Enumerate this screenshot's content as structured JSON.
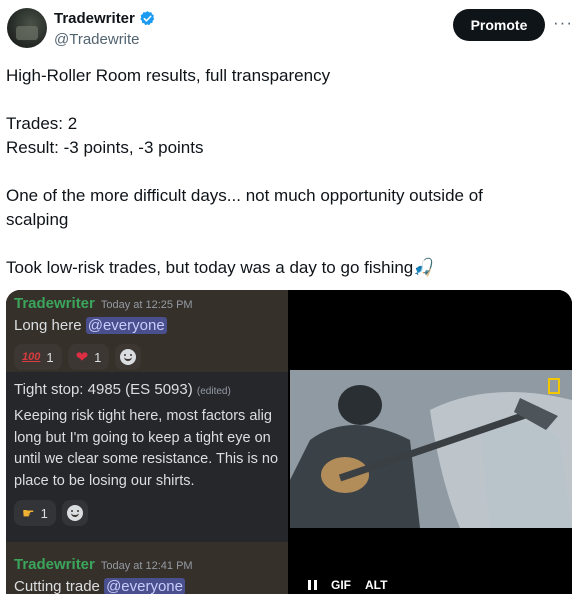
{
  "author": {
    "name": "Tradewriter",
    "handle": "@Tradewrite",
    "verified": true
  },
  "header": {
    "promote_label": "Promote",
    "more_label": "···"
  },
  "tweet": {
    "line1": "High-Roller Room results, full transparency",
    "line2": "Trades: 2",
    "line3": "Result: -3 points, -3 points",
    "line4": "One of the more difficult days... not much opportunity outside of",
    "line5": "scalping",
    "line6": "Took low-risk trades, but today was a day to go fishing🎣"
  },
  "discord": {
    "msg1": {
      "author": "Tradewriter",
      "time": "Today at 12:25 PM",
      "text": "Long here ",
      "mention": "@everyone",
      "reactions": [
        {
          "icon": "hundred-points-icon",
          "glyph": "100",
          "count": "1"
        },
        {
          "icon": "heart-icon",
          "glyph": "❤",
          "count": "1"
        }
      ]
    },
    "stop_text": "Tight stop: 4985 (ES 5093)",
    "edited_label": "(edited)",
    "paragraph": [
      "Keeping risk tight here, most factors alig",
      "long but I'm going to keep a tight eye on",
      "until we clear some resistance. This is no",
      "place to be losing our shirts."
    ],
    "reaction2": {
      "icon": "pointing-hand-icon",
      "glyph": "☛",
      "count": "1"
    },
    "msg2": {
      "author": "Tradewriter",
      "time": "Today at 12:41 PM",
      "text": "Cutting trade ",
      "mention": "@everyone"
    }
  },
  "video": {
    "gif_label": "GIF",
    "alt_label": "ALT"
  },
  "colors": {
    "verified": "#1d9bf0",
    "discord_author": "#3ba55c",
    "mention_bg": "#4a4f8e"
  }
}
